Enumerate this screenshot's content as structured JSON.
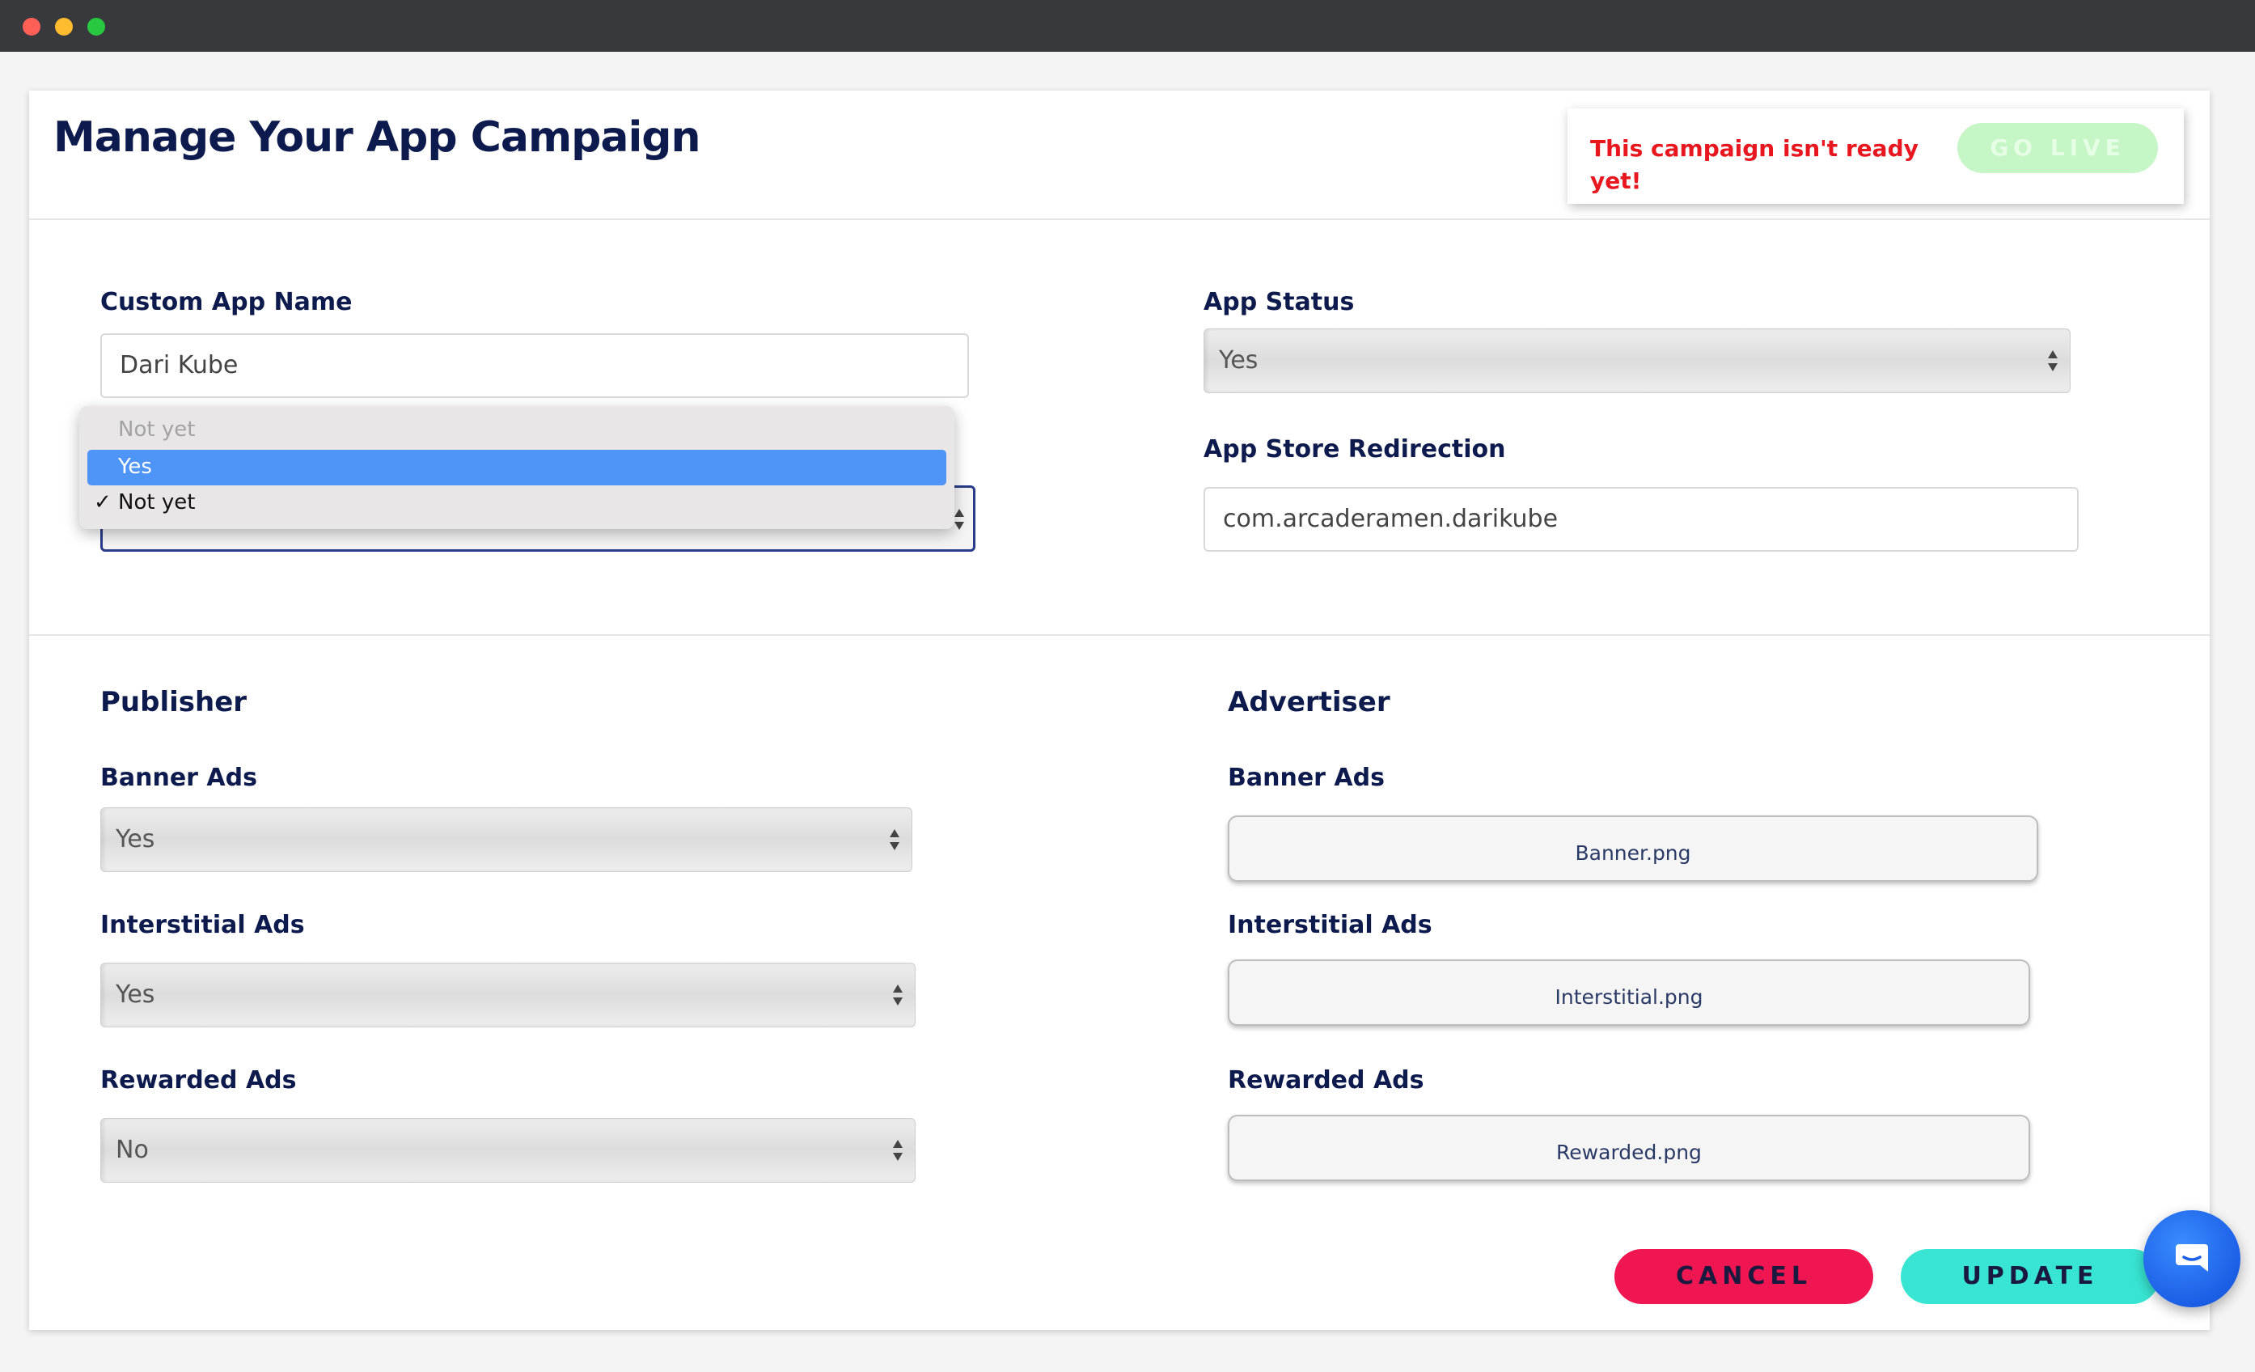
{
  "page": {
    "title": "Manage Your App Campaign",
    "status_message": "This campaign isn't ready yet!",
    "go_live_label": "GO LIVE"
  },
  "form": {
    "custom_app_name": {
      "label": "Custom App Name",
      "value": "Dari Kube"
    },
    "app_status": {
      "label": "App Status",
      "value": "Yes"
    },
    "app_store_redirection": {
      "label": "App Store Redirection",
      "value": "com.arcaderamen.darikube"
    },
    "open_dropdown": {
      "options": [
        {
          "label": "Not yet",
          "state": "disabled"
        },
        {
          "label": "Yes",
          "state": "highlighted"
        },
        {
          "label": "Not yet",
          "state": "checked"
        }
      ],
      "check_glyph": "✓"
    }
  },
  "publisher": {
    "title": "Publisher",
    "banner_ads": {
      "label": "Banner Ads",
      "value": "Yes"
    },
    "interstitial_ads": {
      "label": "Interstitial Ads",
      "value": "Yes"
    },
    "rewarded_ads": {
      "label": "Rewarded Ads",
      "value": "No"
    }
  },
  "advertiser": {
    "title": "Advertiser",
    "banner_ads": {
      "label": "Banner Ads",
      "file": "Banner.png"
    },
    "interstitial_ads": {
      "label": "Interstitial Ads",
      "file": "Interstitial.png"
    },
    "rewarded_ads": {
      "label": "Rewarded Ads",
      "file": "Rewarded.png"
    }
  },
  "actions": {
    "cancel_label": "CANCEL",
    "update_label": "UPDATE"
  },
  "icons": {
    "chat": "chat-bubble-icon",
    "select_arrows": "updown-arrows-icon"
  },
  "colors": {
    "title_navy": "#0d1a4d",
    "warning_red": "#e8161f",
    "go_live_green": "#c6f6c6",
    "cancel_pink": "#f01651",
    "update_teal": "#38e5d3",
    "chat_blue": "#1b5fe6",
    "highlight_blue": "#4f95f7"
  }
}
